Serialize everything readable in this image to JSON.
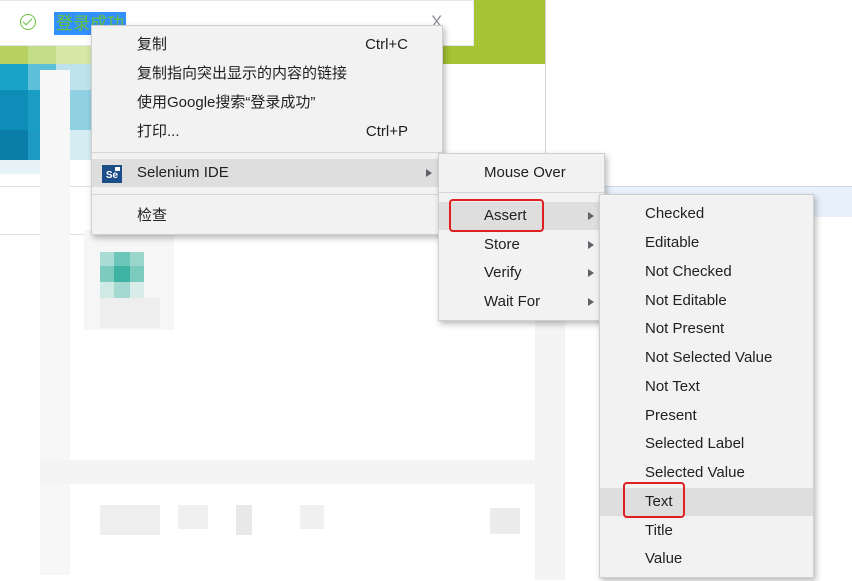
{
  "toast": {
    "message": "登录成功",
    "close_glyph": "X"
  },
  "context_menu": {
    "items": [
      {
        "label": "复制",
        "shortcut": "Ctrl+C"
      },
      {
        "label": "复制指向突出显示的内容的链接"
      },
      {
        "label": "使用Google搜索“登录成功”"
      },
      {
        "label": "打印...",
        "shortcut": "Ctrl+P"
      },
      {
        "label": "Selenium IDE",
        "icon": "selenium-ide-icon",
        "icon_text": "Se"
      },
      {
        "label": "检查"
      }
    ]
  },
  "selenium_menu": {
    "items": [
      {
        "label": "Mouse Over"
      },
      {
        "label": "Assert"
      },
      {
        "label": "Store"
      },
      {
        "label": "Verify"
      },
      {
        "label": "Wait For"
      }
    ]
  },
  "assert_menu": {
    "items": [
      {
        "label": "Checked"
      },
      {
        "label": "Editable"
      },
      {
        "label": "Not Checked"
      },
      {
        "label": "Not Editable"
      },
      {
        "label": "Not Present"
      },
      {
        "label": "Not Selected Value"
      },
      {
        "label": "Not Text"
      },
      {
        "label": "Present"
      },
      {
        "label": "Selected Label"
      },
      {
        "label": "Selected Value"
      },
      {
        "label": "Text"
      },
      {
        "label": "Title"
      },
      {
        "label": "Value"
      }
    ]
  },
  "colors": {
    "menu_bg": "#f2f2f2",
    "highlight": "#dedede",
    "annotation_red": "#e02020",
    "success_green": "#67c23a",
    "selection_blue": "#3390ff",
    "header_green": "#a6c534"
  }
}
